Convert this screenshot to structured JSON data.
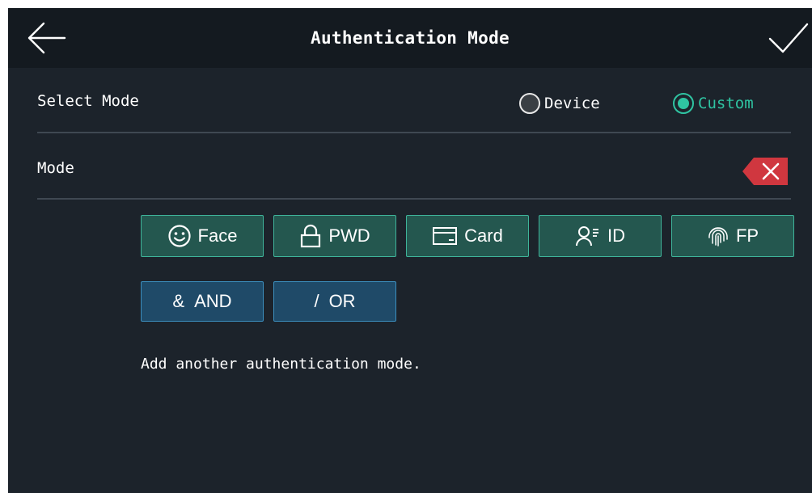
{
  "header": {
    "title": "Authentication Mode",
    "back_icon": "arrow-left-icon",
    "confirm_icon": "checkmark-icon"
  },
  "select_mode": {
    "label": "Select Mode",
    "options": [
      {
        "label": "Device",
        "selected": false
      },
      {
        "label": "Custom",
        "selected": true
      }
    ]
  },
  "mode": {
    "label": "Mode",
    "clear_icon": "backspace-clear-icon"
  },
  "auth_buttons": [
    {
      "label": "Face",
      "icon": "smiley-face-icon"
    },
    {
      "label": "PWD",
      "icon": "padlock-icon"
    },
    {
      "label": "Card",
      "icon": "card-icon"
    },
    {
      "label": "ID",
      "icon": "person-id-icon"
    },
    {
      "label": "FP",
      "icon": "fingerprint-icon"
    }
  ],
  "logic_buttons": [
    {
      "symbol": "&",
      "label": "AND"
    },
    {
      "symbol": "/",
      "label": "OR"
    }
  ],
  "hint": "Add another authentication mode.",
  "colors": {
    "background": "#1c232b",
    "header_background": "#141a20",
    "accent_teal": "#2fc4a2",
    "mode_chip_fill": "#24574f",
    "logic_chip_fill": "#1f4a68",
    "clear_red": "#d0373f"
  }
}
